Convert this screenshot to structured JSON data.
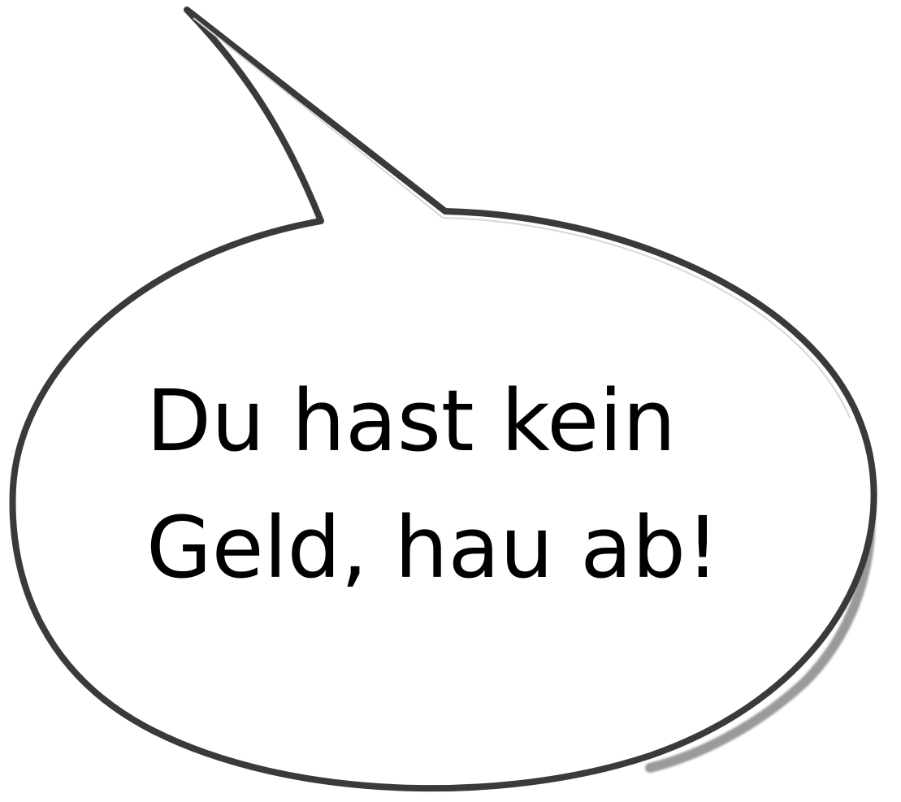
{
  "speech_bubble": {
    "lines": [
      "Du hast kein",
      "Geld, hau ab!"
    ],
    "outline_color": "#3a3a3a",
    "shadow_color": "#9a9a9a",
    "fill_color": "#ffffff",
    "text_color": "#000000"
  }
}
